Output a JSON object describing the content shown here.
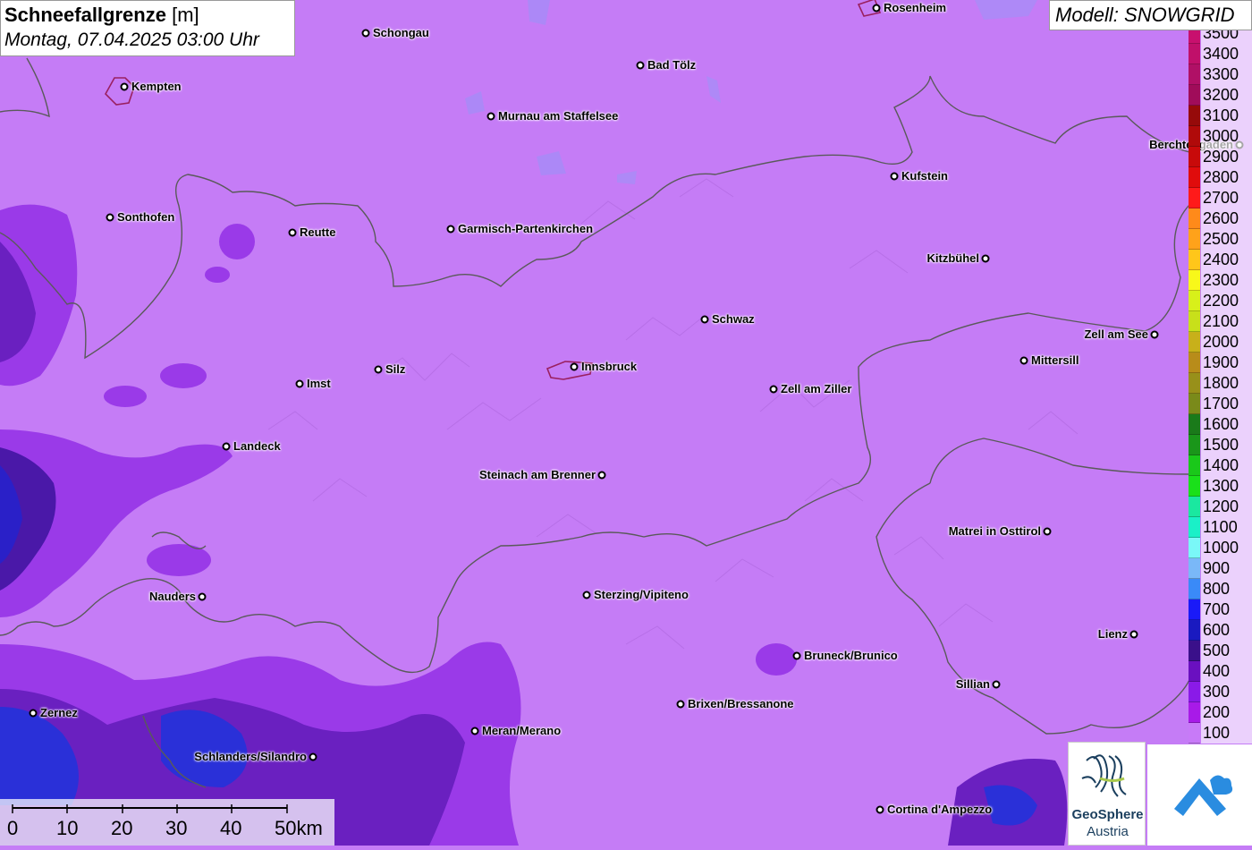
{
  "title": {
    "main": "Schneefallgrenze",
    "unit": "[m]",
    "datetime": "Montag, 07.04.2025 03:00 Uhr"
  },
  "model": {
    "label": "Modell: SNOWGRID"
  },
  "legend": [
    {
      "label": "3500",
      "color": "#c8106e"
    },
    {
      "label": "3400",
      "color": "#c0106a"
    },
    {
      "label": "3300",
      "color": "#b01066"
    },
    {
      "label": "3200",
      "color": "#a00c5a"
    },
    {
      "label": "3100",
      "color": "#960a0a"
    },
    {
      "label": "3000",
      "color": "#b00a0a"
    },
    {
      "label": "2900",
      "color": "#c80a0a"
    },
    {
      "label": "2800",
      "color": "#e00c0c"
    },
    {
      "label": "2700",
      "color": "#ff1a1a"
    },
    {
      "label": "2600",
      "color": "#ff8a1a"
    },
    {
      "label": "2500",
      "color": "#ffa21a"
    },
    {
      "label": "2400",
      "color": "#ffc61a"
    },
    {
      "label": "2300",
      "color": "#f8f81a"
    },
    {
      "label": "2200",
      "color": "#d8f01a"
    },
    {
      "label": "2100",
      "color": "#c8e01a"
    },
    {
      "label": "2000",
      "color": "#c8b01a"
    },
    {
      "label": "1900",
      "color": "#b88c1a"
    },
    {
      "label": "1800",
      "color": "#98901a"
    },
    {
      "label": "1700",
      "color": "#7a8a1a"
    },
    {
      "label": "1600",
      "color": "#1a7a1a"
    },
    {
      "label": "1500",
      "color": "#1a961a"
    },
    {
      "label": "1400",
      "color": "#1ac81a"
    },
    {
      "label": "1300",
      "color": "#1ae01a"
    },
    {
      "label": "1200",
      "color": "#1ae8a0"
    },
    {
      "label": "1100",
      "color": "#1af0c8"
    },
    {
      "label": "1000",
      "color": "#7af8f8"
    },
    {
      "label": "900",
      "color": "#7ab8f8"
    },
    {
      "label": "800",
      "color": "#3a8af8"
    },
    {
      "label": "700",
      "color": "#1a1af8"
    },
    {
      "label": "600",
      "color": "#1a1ac0"
    },
    {
      "label": "500",
      "color": "#3a108a"
    },
    {
      "label": "400",
      "color": "#6a10c0"
    },
    {
      "label": "300",
      "color": "#8a1ae8"
    },
    {
      "label": "200",
      "color": "#a81ae8"
    },
    {
      "label": "100",
      "color": "#c87af8"
    }
  ],
  "scale": {
    "ticks": [
      "0",
      "10",
      "20",
      "30",
      "40",
      "50km"
    ]
  },
  "logo": {
    "line1": "GeoSphere",
    "line2": "Austria"
  },
  "cities": [
    {
      "name": "Rosenheim",
      "side": "right"
    },
    {
      "name": "Schongau",
      "side": "right"
    },
    {
      "name": "Kempten",
      "side": "right"
    },
    {
      "name": "Bad Tölz",
      "side": "right"
    },
    {
      "name": "Murnau am Staffelsee",
      "side": "right"
    },
    {
      "name": "Berchtesgaden",
      "side": "left"
    },
    {
      "name": "Kufstein",
      "side": "right"
    },
    {
      "name": "Sonthofen",
      "side": "right"
    },
    {
      "name": "Reutte",
      "side": "right"
    },
    {
      "name": "Garmisch-Partenkirchen",
      "side": "right"
    },
    {
      "name": "Kitzbühel",
      "side": "left"
    },
    {
      "name": "Schwaz",
      "side": "right"
    },
    {
      "name": "Zell am See",
      "side": "left"
    },
    {
      "name": "Mittersill",
      "side": "right"
    },
    {
      "name": "Silz",
      "side": "right"
    },
    {
      "name": "Innsbruck",
      "side": "right"
    },
    {
      "name": "Imst",
      "side": "right"
    },
    {
      "name": "Zell am Ziller",
      "side": "right"
    },
    {
      "name": "Landeck",
      "side": "right"
    },
    {
      "name": "Steinach am Brenner",
      "side": "left"
    },
    {
      "name": "Matrei in Osttirol",
      "side": "left"
    },
    {
      "name": "Nauders",
      "side": "left"
    },
    {
      "name": "Sterzing/Vipiteno",
      "side": "right"
    },
    {
      "name": "Lienz",
      "side": "left"
    },
    {
      "name": "Bruneck/Brunico",
      "side": "right"
    },
    {
      "name": "Sillian",
      "side": "left"
    },
    {
      "name": "Brixen/Bressanone",
      "side": "right"
    },
    {
      "name": "Zernez",
      "side": "right"
    },
    {
      "name": "Meran/Merano",
      "side": "right"
    },
    {
      "name": "Schlanders/Silandro",
      "side": "left"
    },
    {
      "name": "Cortina d'Ampezzo",
      "side": "right"
    }
  ]
}
